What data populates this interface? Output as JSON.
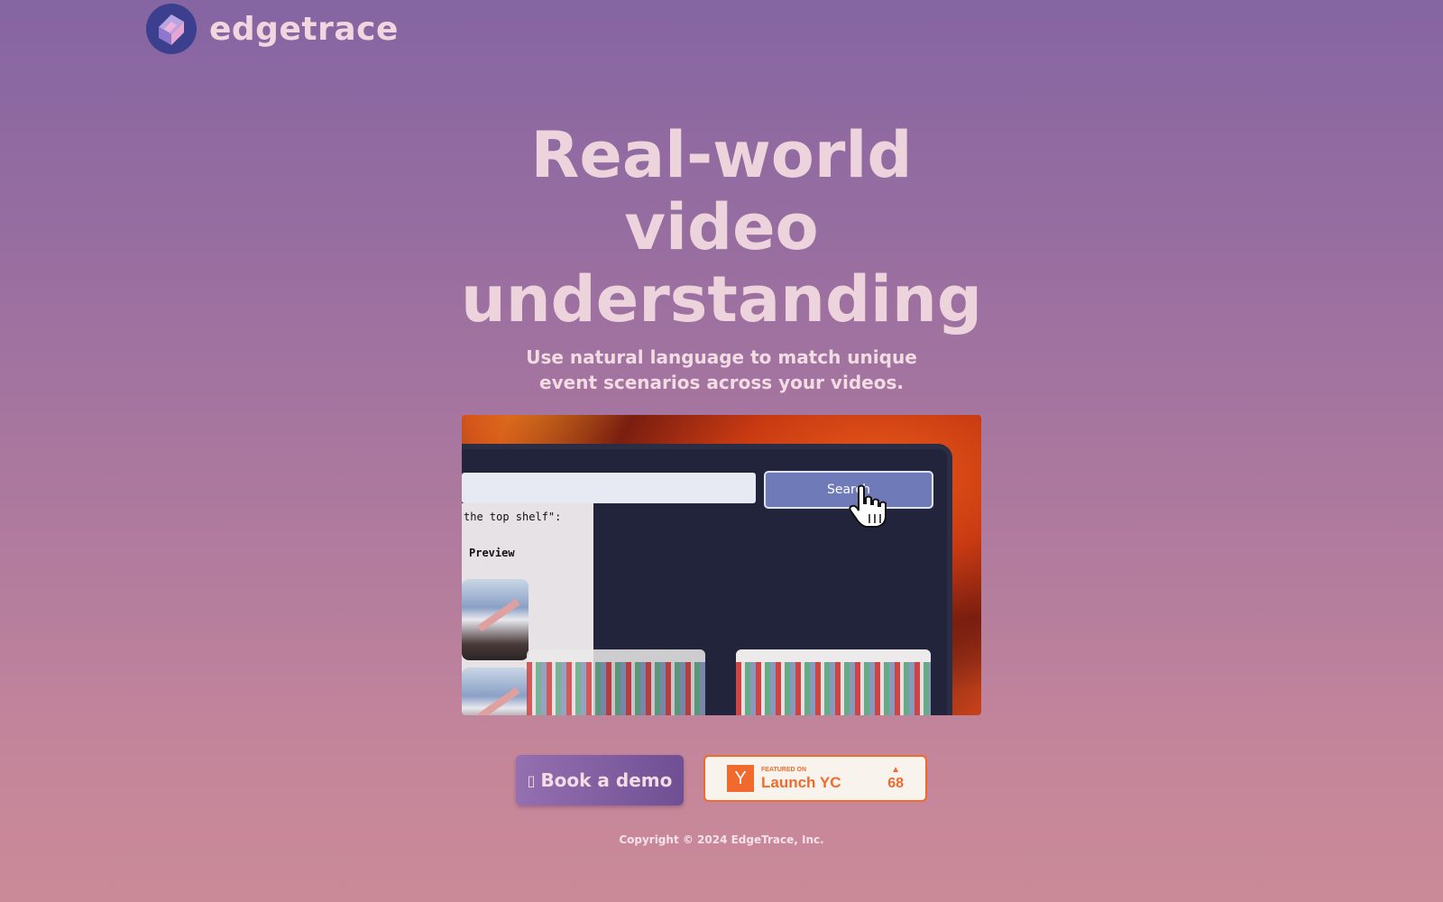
{
  "brand": {
    "name": "edgetrace"
  },
  "hero": {
    "title": "Real-world video understanding",
    "subtitle": "Use natural language to match unique event scenarios across your videos."
  },
  "demo": {
    "search_button": "Search",
    "query_text": "the top shelf\":",
    "preview_label": "Preview"
  },
  "cta": {
    "book_demo": "Book a demo",
    "calendar_icon": "calendar-icon",
    "yc_featured": "FEATURED ON",
    "yc_name": "Launch YC",
    "yc_logo": "Y",
    "yc_votes": "68"
  },
  "footer": {
    "copyright": "Copyright © 2024 EdgeTrace, Inc."
  },
  "colors": {
    "accent_orange": "#ef6a2c",
    "logo_bg": "#3b3f8e",
    "search_button": "#6f7ab8"
  }
}
